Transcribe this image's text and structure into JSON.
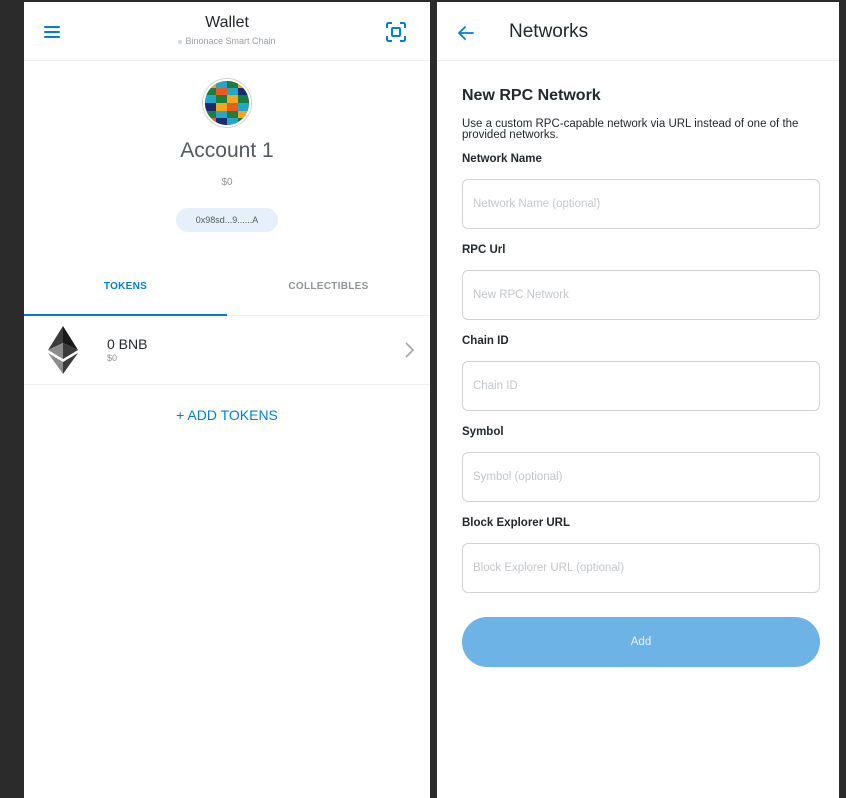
{
  "wallet": {
    "header": {
      "title": "Wallet",
      "network": "Binonace Smart Chain"
    },
    "account": {
      "name": "Account 1",
      "balance": "$0",
      "address": "0x98sd...9......A"
    },
    "tabs": [
      {
        "label": "TOKENS",
        "active": true
      },
      {
        "label": "COLLECTIBLES",
        "active": false
      }
    ],
    "tokens": [
      {
        "amount": "0 BNB",
        "fiat": "$0",
        "icon": "ethereum-icon"
      }
    ],
    "add_tokens_label": "+ ADD TOKENS"
  },
  "networks": {
    "header": {
      "title": "Networks"
    },
    "form": {
      "heading": "New RPC Network",
      "description": "Use a custom RPC-capable network via URL instead of one of the provided networks.",
      "fields": [
        {
          "label": "Network Name",
          "placeholder": "Network Name (optional)",
          "value": ""
        },
        {
          "label": "RPC Url",
          "placeholder": "New RPC Network",
          "value": ""
        },
        {
          "label": "Chain ID",
          "placeholder": "Chain ID",
          "value": ""
        },
        {
          "label": "Symbol",
          "placeholder": "Symbol (optional)",
          "value": ""
        },
        {
          "label": "Block Explorer URL",
          "placeholder": "Block Explorer URL (optional)",
          "value": ""
        }
      ],
      "add_button_label": "Add"
    }
  },
  "colors": {
    "accent": "#037dd6",
    "add_button_disabled": "#6eb3e6",
    "address_pill": "#e6f0fb"
  }
}
